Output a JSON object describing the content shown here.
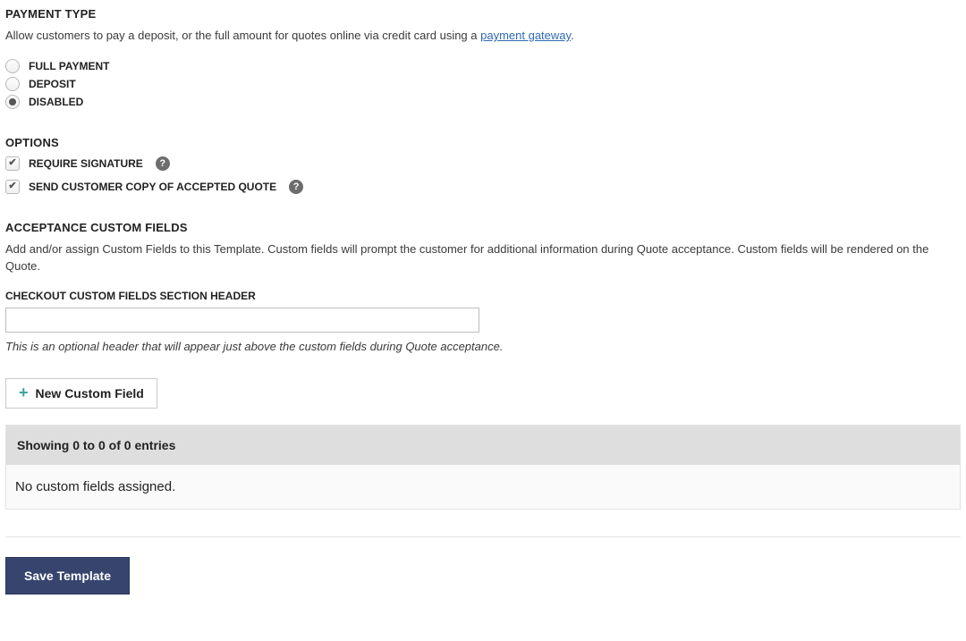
{
  "payment": {
    "title": "PAYMENT TYPE",
    "desc_prefix": "Allow customers to pay a deposit, or the full amount for quotes online via credit card using a ",
    "link_text": "payment gateway",
    "desc_suffix": ".",
    "options": {
      "full": "FULL PAYMENT",
      "deposit": "DEPOSIT",
      "disabled": "DISABLED"
    },
    "selected": "disabled"
  },
  "opts": {
    "title": "OPTIONS",
    "require_sig": "REQUIRE SIGNATURE",
    "send_copy": "SEND CUSTOMER COPY OF ACCEPTED QUOTE",
    "help_glyph": "?"
  },
  "custom": {
    "title": "ACCEPTANCE CUSTOM FIELDS",
    "desc": "Add and/or assign Custom Fields to this Template. Custom fields will prompt the customer for additional information during Quote acceptance. Custom fields will be rendered on the Quote.",
    "header_label": "CHECKOUT CUSTOM FIELDS SECTION HEADER",
    "header_value": "",
    "header_help": "This is an optional header that will appear just above the custom fields during Quote acceptance.",
    "new_btn": "New Custom Field",
    "table_head": "Showing 0 to 0 of 0 entries",
    "table_empty": "No custom fields assigned."
  },
  "save_btn": "Save Template"
}
